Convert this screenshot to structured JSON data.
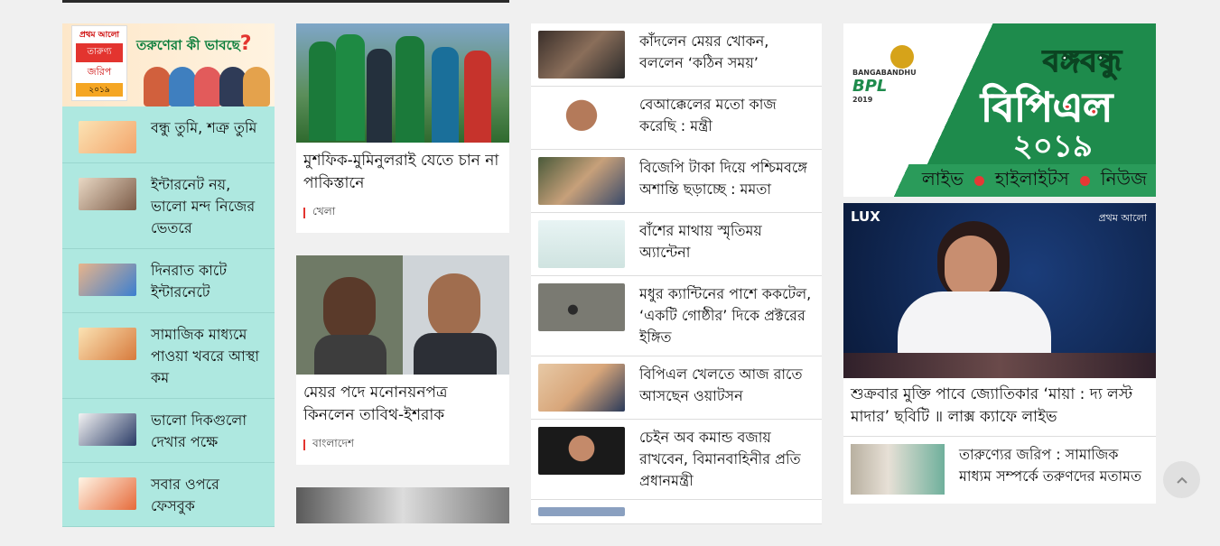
{
  "tarunya": {
    "banner": {
      "logo_top": "প্রথম আলো",
      "logo_mid": "তারুণ্য",
      "logo_label": "জরিপ",
      "logo_year": "২০১৯",
      "question": "তরুণেরা কী ভাবছে",
      "qmark": "?"
    },
    "items": [
      {
        "title": "বন্ধু তুমি, শত্রু তুমি"
      },
      {
        "title": "ইন্টারনেট নয়, ভালো মন্দ নিজের ভেতরে"
      },
      {
        "title": "দিনরাত কাটে ইন্টারনেটে"
      },
      {
        "title": "সামাজিক মাধ্যমে পাওয়া খবরে আস্থা কম"
      },
      {
        "title": "ভালো দিকগুলো দেখার পক্ষে"
      },
      {
        "title": "সবার ওপরে ফেসবুক"
      }
    ]
  },
  "lead_cards": [
    {
      "title": "মুশফিক-মুমিনুলরাই যেতে চান না পাকিস্তানে",
      "category": "খেলা"
    },
    {
      "title": "মেয়র পদে মনোনয়নপত্র কিনলেন তাবিথ-ইশরাক",
      "category": "বাংলাদেশ"
    }
  ],
  "news_list": [
    {
      "title": "কাঁদলেন মেয়র খোকন, বললেন ‘কঠিন সময়’"
    },
    {
      "title": "বেআক্কেলের মতো কাজ করেছি : মন্ত্রী"
    },
    {
      "title": "বিজেপি টাকা দিয়ে পশ্চিমবঙ্গে অশান্তি ছড়াচ্ছে : মমতা"
    },
    {
      "title": "বাঁশের মাথায় স্মৃতিময় অ্যান্টেনা"
    },
    {
      "title": "মধুর ক্যান্টিনের পাশে ককটেল, ‘একটি গোষ্ঠীর’ দিকে প্রক্টরের ইঙ্গিত"
    },
    {
      "title": "বিপিএল খেলতে আজ রাতে আসছেন ওয়াটসন"
    },
    {
      "title": "চেইন অব কমান্ড বজায় রাখবেন, বিমানবাহিনীর প্রতি প্রধানমন্ত্রী"
    }
  ],
  "bpl_banner": {
    "brand": "BPL",
    "brand_top": "BANGABANDHU",
    "brand_year": "2019",
    "line1": "বঙ্গবন্ধু",
    "line2": "বিপিএল",
    "line3": "২০১৯",
    "links": [
      "লাইভ",
      "হাইলাইটস",
      "নিউজ"
    ]
  },
  "video": {
    "tag_left": "LUX",
    "tag_right": "প্রথম আলো",
    "title": "শুক্রবার মুক্তি পাবে জ্যোতিকার ‘মায়া : দ্য লস্ট মাদার’ ছবিটি ॥ লাক্স ক্যাফে লাইভ"
  },
  "video_news": {
    "title": "তারুণ্যের জরিপ : সামাজিক মাধ্যম সম্পর্কে তরুণদের মতামত"
  },
  "colors": {
    "accent_red": "#e3342f",
    "teal_panel": "#aee8e0",
    "bpl_green": "#1e8b4c"
  },
  "icons": {
    "back_to_top": "chevron-up-icon"
  }
}
